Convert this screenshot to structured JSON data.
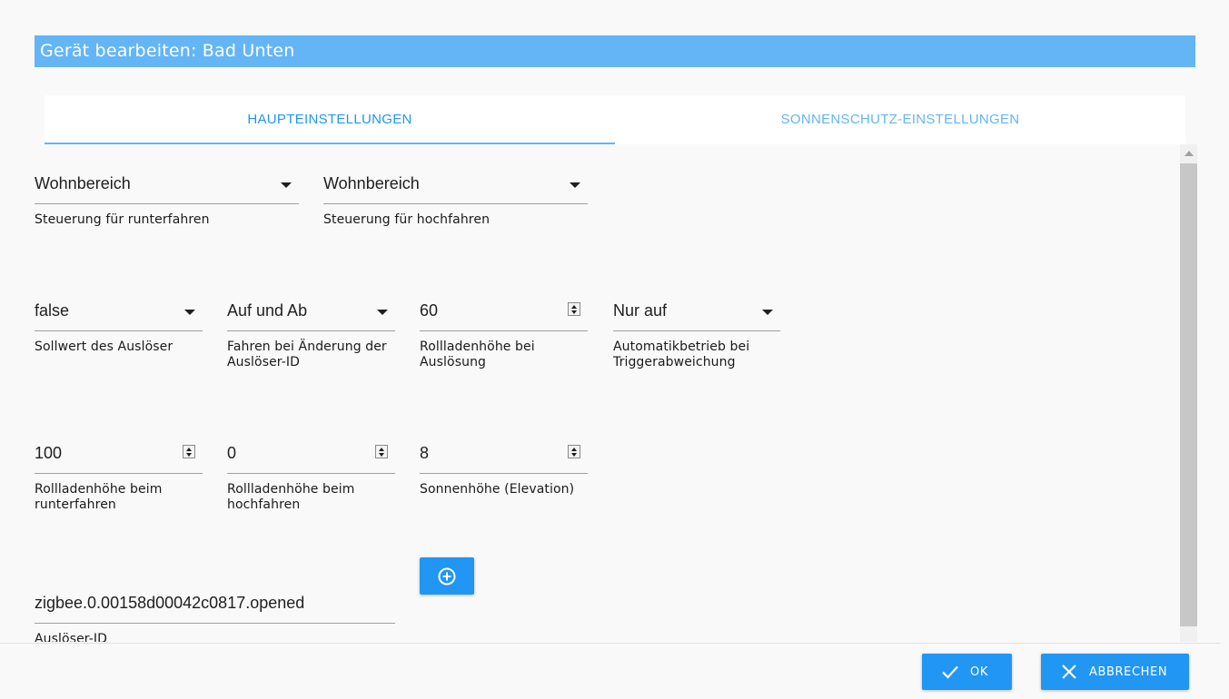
{
  "dialog": {
    "title": "Gerät bearbeiten: Bad Unten"
  },
  "tabs": [
    {
      "label": "HAUPTEINSTELLUNGEN",
      "active": true
    },
    {
      "label": "SONNENSCHUTZ-EINSTELLUNGEN",
      "active": false
    }
  ],
  "fields": {
    "control_down": {
      "value": "Wohnbereich",
      "label": "Steuerung für runterfahren",
      "type": "select"
    },
    "control_up": {
      "value": "Wohnbereich",
      "label": "Steuerung für hochfahren",
      "type": "select"
    },
    "trigger_setpoint": {
      "value": "false",
      "label": "Sollwert des Auslöser",
      "type": "select"
    },
    "trigger_change_drive": {
      "value": "Auf und Ab",
      "label": "Fahren bei Änderung der Auslöser-ID",
      "type": "select"
    },
    "trigger_height": {
      "value": "60",
      "label": "Rollladenhöhe bei Auslösung",
      "type": "number"
    },
    "auto_mode": {
      "value": "Nur auf",
      "label": "Automatikbetrieb bei Triggerabweichung",
      "type": "select"
    },
    "height_down": {
      "value": "100",
      "label": "Rollladenhöhe beim runterfahren",
      "type": "number"
    },
    "height_up": {
      "value": "0",
      "label": "Rollladenhöhe beim hochfahren",
      "type": "number"
    },
    "sun_elevation": {
      "value": "8",
      "label": "Sonnenhöhe (Elevation)",
      "type": "number"
    },
    "trigger_id": {
      "value": "zigbee.0.00158d00042c0817.opened",
      "label": "Auslöser-ID",
      "type": "text"
    }
  },
  "footer": {
    "ok_label": "OK",
    "cancel_label": "ABBRECHEN"
  },
  "colors": {
    "title_bar": "#64b5f6",
    "primary": "#2196f3",
    "tab_inactive": "#64b5f6"
  },
  "icons": {
    "add": "plus-circle-icon",
    "ok": "check-icon",
    "cancel": "close-icon"
  }
}
